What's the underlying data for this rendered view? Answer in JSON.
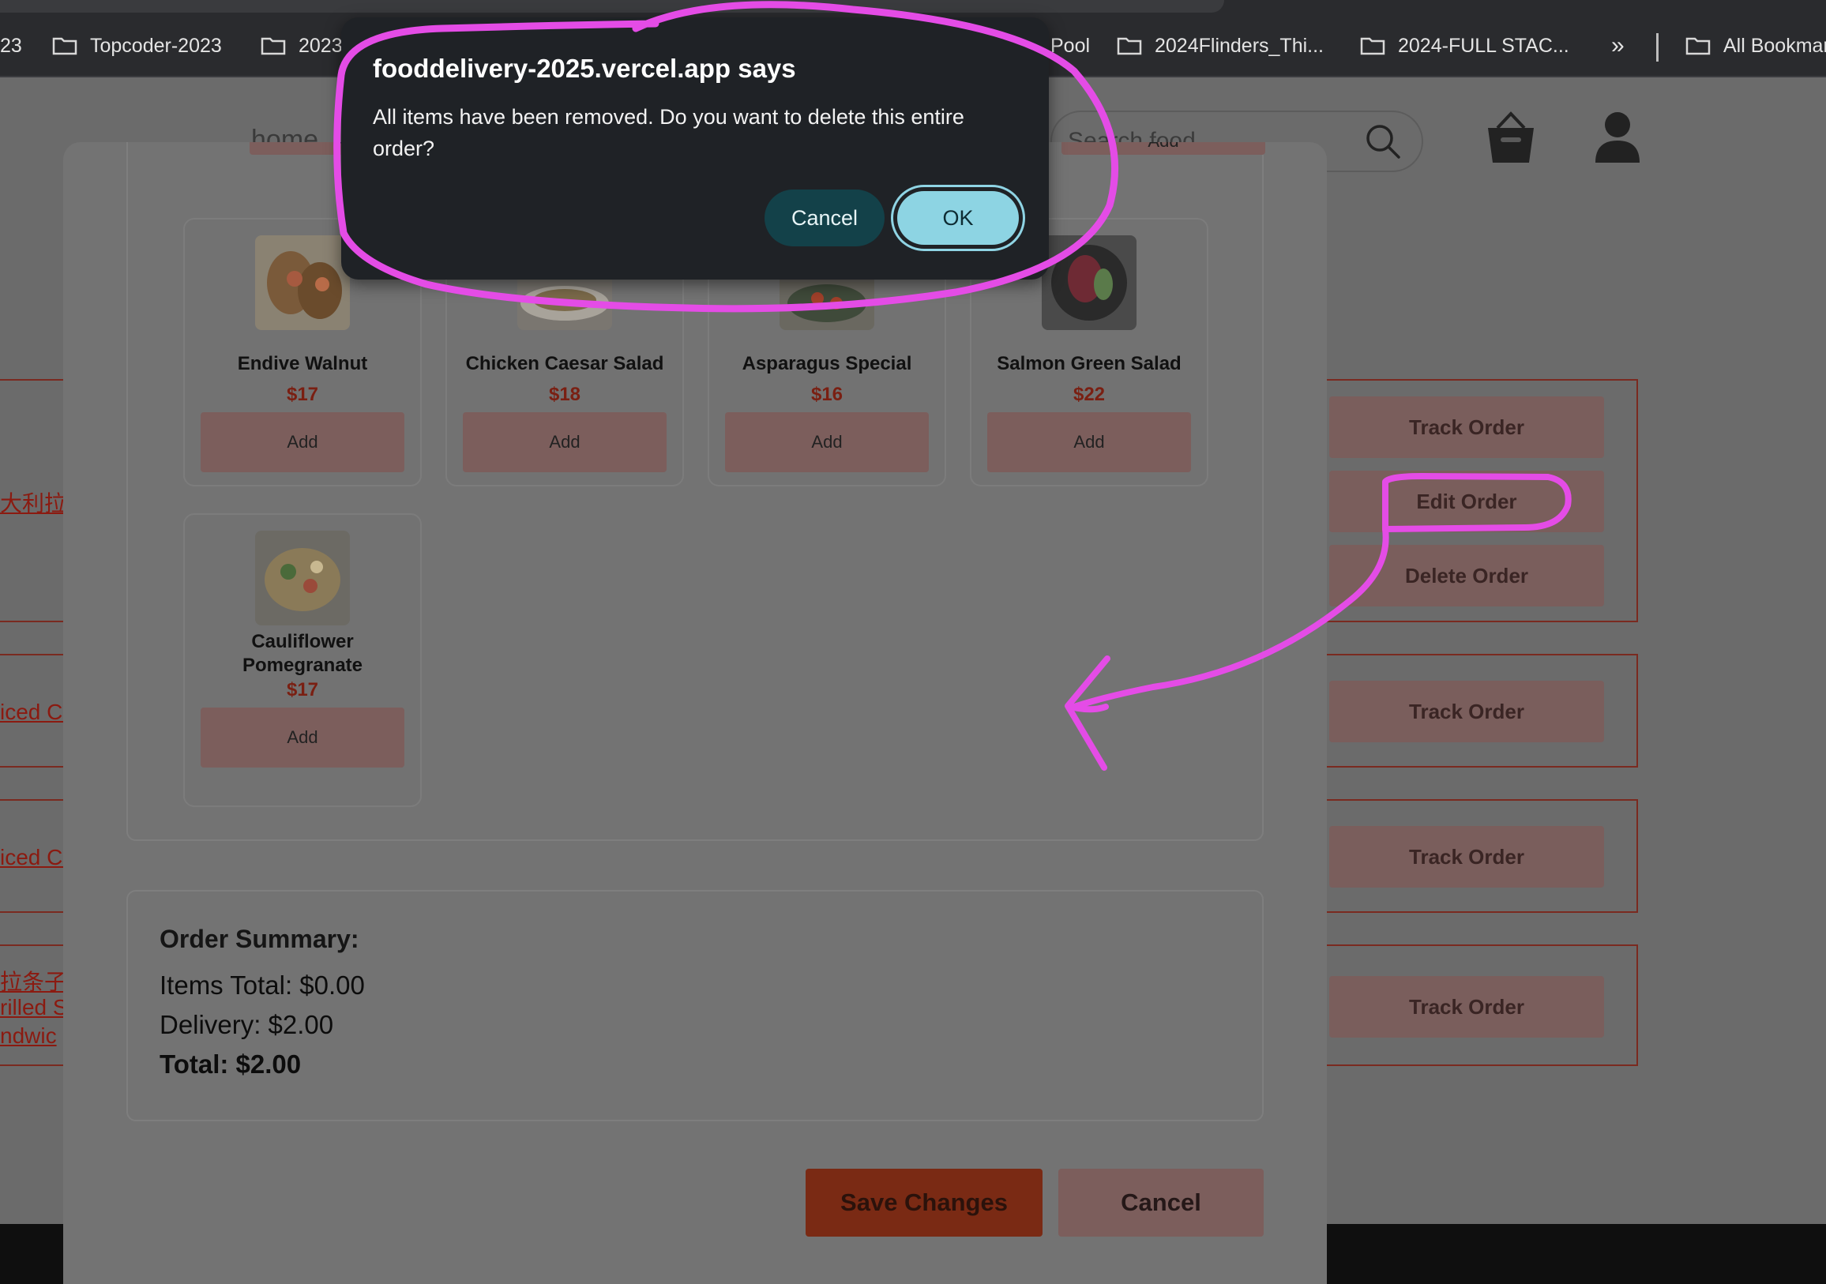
{
  "bookmarks": {
    "items": [
      {
        "label": "23",
        "folder": false
      },
      {
        "label": "Topcoder-2023",
        "folder": true
      },
      {
        "label": "2023",
        "folder": true
      },
      {
        "label": "Pool",
        "folder": false
      },
      {
        "label": "2024Flinders_Thi...",
        "folder": true
      },
      {
        "label": "2024-FULL STAC...",
        "folder": true
      },
      {
        "label": "All Bookmarks",
        "folder": true
      }
    ],
    "overflow": "»"
  },
  "header": {
    "home_label": "home",
    "search_placeholder": "Search food"
  },
  "orders": {
    "links": [
      "大利拉",
      "iced Co",
      "iced Co",
      "拉条子",
      "rilled S",
      "ndwic"
    ],
    "track_label": "Track Order",
    "edit_label": "Edit Order",
    "delete_label": "Delete Order"
  },
  "edit_modal": {
    "add_label": "Add",
    "foods": [
      {
        "name": "Endive Walnut",
        "price": "$17"
      },
      {
        "name": "Chicken Caesar Salad",
        "price": "$18"
      },
      {
        "name": "Asparagus Special",
        "price": "$16"
      },
      {
        "name": "Salmon Green Salad",
        "price": "$22"
      },
      {
        "name": "Cauliflower Pomegranate",
        "price": "$17"
      }
    ],
    "summary": {
      "title": "Order Summary:",
      "items_total": "Items Total: $0.00",
      "delivery": "Delivery: $2.00",
      "total": "Total: $2.00"
    },
    "save_label": "Save Changes",
    "cancel_label": "Cancel"
  },
  "alert": {
    "title": "fooddelivery-2025.vercel.app says",
    "message": "All items have been removed. Do you want to delete this entire order?",
    "cancel_label": "Cancel",
    "ok_label": "OK"
  },
  "colors": {
    "annotation": "#e44ce6",
    "accent_red": "#c0392b",
    "dialog_bg": "#1f2226",
    "ok_button": "#8dd4e3"
  }
}
